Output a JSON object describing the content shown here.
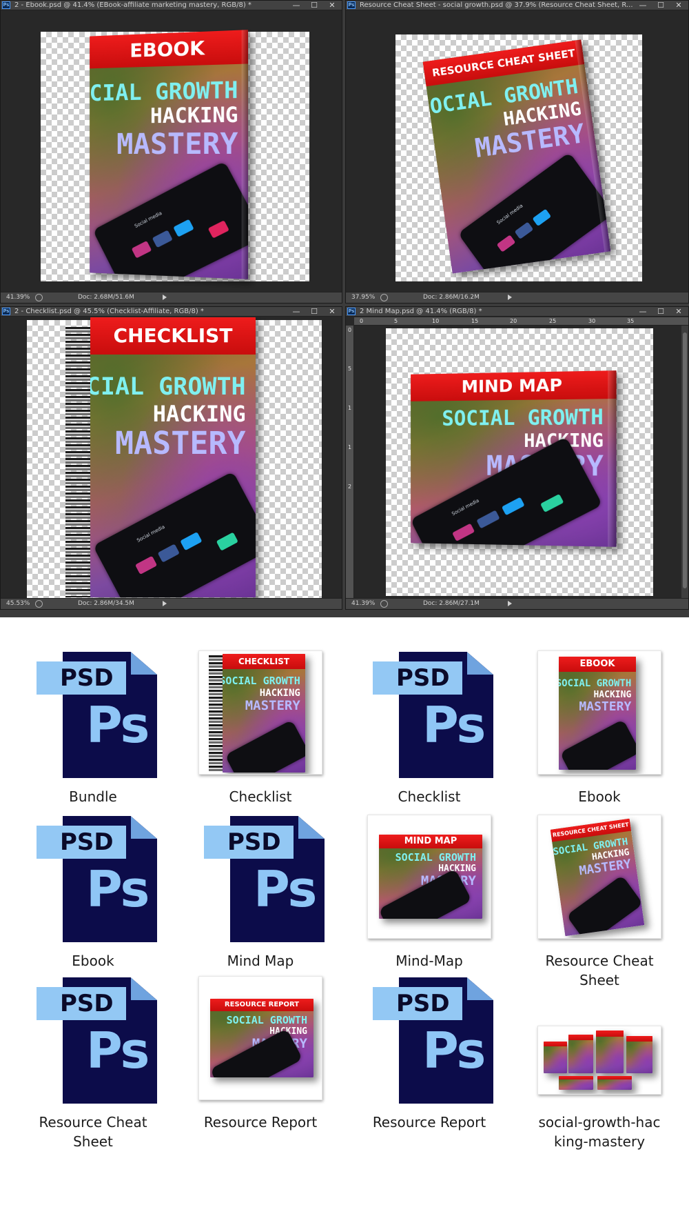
{
  "photoshop": {
    "windows": [
      {
        "id": "ebook",
        "title": "2 - Ebook.psd @ 41.4% (EBook-affiliate marketing mastery, RGB/8) *",
        "zoom": "41.39%",
        "doc_size": "Doc: 2.68M/51.6M"
      },
      {
        "id": "cheat",
        "title": "Resource Cheat Sheet - social growth.psd @ 37.9% (Resource Cheat Sheet, R...",
        "zoom": "37.95%",
        "doc_size": "Doc: 2.86M/16.2M"
      },
      {
        "id": "checklist",
        "title": "2 - Checklist.psd @ 45.5% (Checklist-Affiliate, RGB/8) *",
        "zoom": "45.53%",
        "doc_size": "Doc: 2.86M/34.5M"
      },
      {
        "id": "mindmap",
        "title": "2 Mind Map.psd @ 41.4% (RGB/8) *",
        "zoom": "41.39%",
        "doc_size": "Doc: 2.86M/27.1M"
      }
    ],
    "window_controls": {
      "minimize": "—",
      "maximize": "☐",
      "close": "✕"
    },
    "ps_badge": "Ps",
    "ruler_top": [
      "0",
      "5",
      "10",
      "15",
      "20",
      "25",
      "30",
      "35"
    ],
    "ruler_left": [
      "0",
      "5",
      "1",
      "1",
      "2"
    ]
  },
  "cover_text": {
    "line1": "SOCIAL GROWTH",
    "line2": "HACKING",
    "line3": "MASTERY",
    "phone_label": "Social media",
    "bands": {
      "ebook": "EBOOK",
      "cheat": "RESOURCE CHEAT SHEET",
      "checklist": "CHECKLIST",
      "mindmap": "MIND MAP",
      "report": "RESOURCE REPORT"
    }
  },
  "psd_icon": {
    "tag": "PSD",
    "glyph": "Ps"
  },
  "files": [
    {
      "label": "Bundle",
      "kind": "psd"
    },
    {
      "label": "Checklist",
      "kind": "thumb-checklist"
    },
    {
      "label": "Checklist",
      "kind": "psd"
    },
    {
      "label": "Ebook",
      "kind": "thumb-ebook"
    },
    {
      "label": "Ebook",
      "kind": "psd"
    },
    {
      "label": "Mind Map",
      "kind": "psd"
    },
    {
      "label": "Mind-Map",
      "kind": "thumb-mindmap"
    },
    {
      "label": "Resource Cheat Sheet",
      "kind": "thumb-cheat"
    },
    {
      "label": "Resource Cheat Sheet",
      "kind": "psd"
    },
    {
      "label": "Resource Report",
      "kind": "thumb-report"
    },
    {
      "label": "Resource Report",
      "kind": "psd"
    },
    {
      "label": "social-growth-hacking-mastery",
      "kind": "thumb-bundle"
    }
  ],
  "colors": {
    "band_red": "#e01414",
    "title_cyan": "#7ff0f0",
    "title_lavender": "#b7b9ff",
    "psd_navy": "#0c0c4a",
    "psd_light": "#93c8f4"
  }
}
